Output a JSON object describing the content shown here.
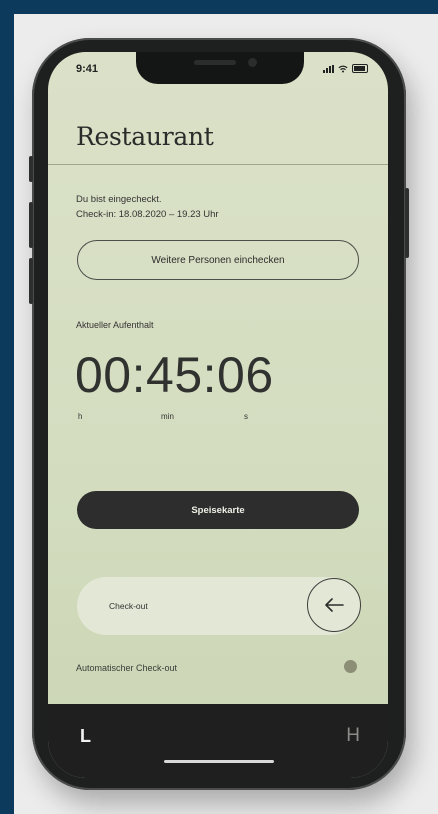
{
  "status_bar": {
    "time": "9:41"
  },
  "header": {
    "title": "Restaurant"
  },
  "checkin": {
    "line1": "Du bist eingecheckt.",
    "line2": "Check-in: 18.08.2020 – 19.23 Uhr"
  },
  "buttons": {
    "add_persons": "Weitere Personen einchecken",
    "menu": "Speisekarte"
  },
  "stay": {
    "label": "Aktueller Aufenthalt",
    "timer": "00:45:06",
    "units": {
      "h": "h",
      "min": "min",
      "s": "s"
    }
  },
  "checkout": {
    "label": "Check-out",
    "icon": "arrow-left-icon"
  },
  "auto_checkout": {
    "label": "Automatischer Check-out",
    "toggle_color": "#8c8f76"
  },
  "tabbar": {
    "left_logo": "L",
    "right_logo": "H"
  },
  "colors": {
    "screen_bg": "#d4ddc0",
    "dark": "#2c2d2c",
    "page_bg": "#0b3a5c"
  }
}
